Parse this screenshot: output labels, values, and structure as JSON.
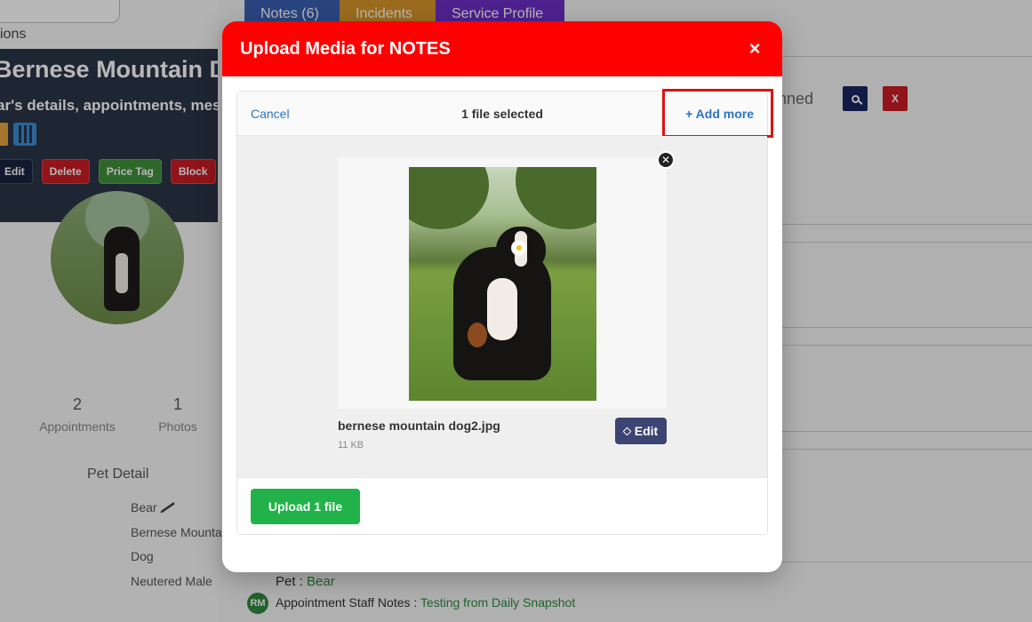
{
  "background": {
    "options_text": "ions",
    "pet_header": {
      "name": "Bernese Mountain Dog",
      "description": "ar's details, appointments, messa",
      "buttons": {
        "edit": "Edit",
        "delete": "Delete",
        "price_tag": "Price Tag",
        "block": "Block"
      }
    },
    "stats": [
      {
        "value": "2",
        "label": "Appointments"
      },
      {
        "value": "1",
        "label": "Photos"
      }
    ],
    "pet_detail": {
      "title": "Pet Detail",
      "rows": [
        "Bear",
        "Bernese Mounta",
        "Dog",
        "Neutered Male"
      ]
    },
    "tabs": [
      "Notes (6)",
      "Incidents",
      "Service Profile"
    ],
    "pinned_text": "nned",
    "close_label": "X",
    "pet_line": {
      "label": "Pet :",
      "value": "Bear"
    },
    "staff_line": {
      "badge": "RM",
      "label": "Appointment Staff Notes :",
      "value": "Testing from Daily Snapshot"
    }
  },
  "modal": {
    "title": "Upload Media for NOTES",
    "close_symbol": "×",
    "uploader": {
      "cancel_label": "Cancel",
      "selection_count": "1 file selected",
      "add_more_label": "+ Add more",
      "file": {
        "name": "bernese mountain dog2.jpg",
        "size": "11 KB",
        "edit_label": "Edit",
        "remove_symbol": "✕"
      },
      "upload_button_label": "Upload 1 file"
    }
  },
  "colors": {
    "modal_header": "#ff0000",
    "upload_button": "#21b34a",
    "edit_button": "#3c4472",
    "link": "#2b73c8",
    "highlight": "#e01010"
  }
}
